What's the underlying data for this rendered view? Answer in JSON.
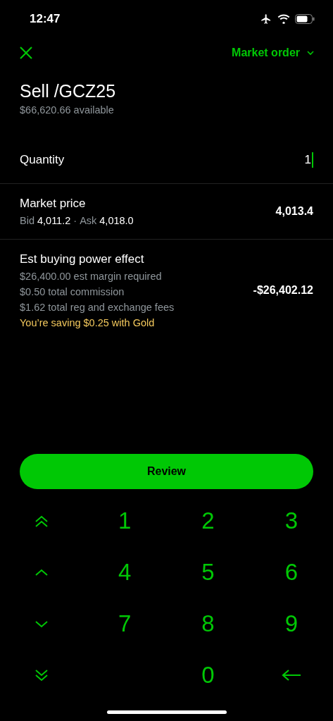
{
  "status_bar": {
    "time": "12:47"
  },
  "header": {
    "order_type": "Market order"
  },
  "title": "Sell /GCZ25",
  "available": "$66,620.66 available",
  "quantity": {
    "label": "Quantity",
    "value": "1"
  },
  "market_price": {
    "label": "Market price",
    "bid_label": "Bid",
    "bid": "4,011.2",
    "separator": "·",
    "ask_label": "Ask",
    "ask": "4,018.0",
    "value": "4,013.4"
  },
  "buying_power": {
    "label": "Est buying power effect",
    "details": [
      "$26,400.00 est margin required",
      "$0.50 total commission",
      "$1.62 total reg and exchange fees"
    ],
    "saving": "You’re saving $0.25 with Gold",
    "value": "-$26,402.12"
  },
  "review_button": "Review",
  "steps": [
    {
      "kind": "double-up"
    },
    {
      "kind": "up"
    },
    {
      "kind": "down"
    },
    {
      "kind": "double-down"
    }
  ],
  "digits": [
    "1",
    "2",
    "3",
    "4",
    "5",
    "6",
    "7",
    "8",
    "9",
    "0"
  ]
}
